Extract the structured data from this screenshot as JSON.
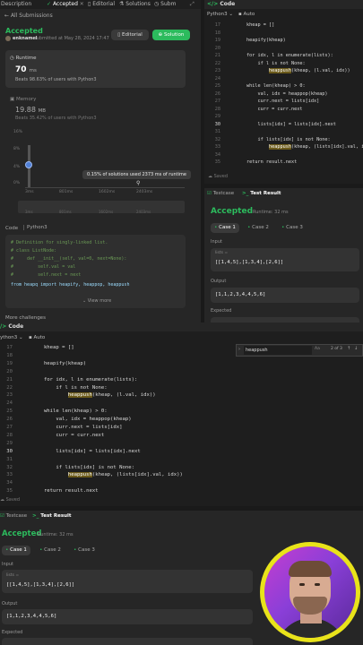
{
  "top_tabs": {
    "description": "Description",
    "accepted": "Accepted",
    "editorial": "Editorial",
    "solutions": "Solutions",
    "submissions_short": "Subm"
  },
  "left": {
    "back_label": "All Submissions",
    "status": "Accepted",
    "author": "enknamel",
    "submitted": "submitted at May 28, 2024 17:47",
    "editorial_btn": "Editorial",
    "solution_btn": "Solution",
    "runtime_label": "Runtime",
    "runtime_value": "70",
    "runtime_unit": "ms",
    "beats_runtime": "Beats 98.63% of users with Python3",
    "memory_label": "Memory",
    "memory_value": "19.88",
    "memory_unit": "MB",
    "beats_memory": "Beats 35.42% of users with Python3",
    "y_ticks": [
      "16%",
      "8%",
      "4%",
      "0%"
    ],
    "x_ticks": [
      "3ms",
      "801ms",
      "1602ms",
      "2403ms"
    ],
    "x_ticks2": [
      "3ms",
      "801ms",
      "1602ms",
      "2403ms"
    ],
    "tooltip": "0.15% of solutions used 2373 ms of runtime",
    "code_label": "Code",
    "lang": "Python3",
    "code_lines": [
      "# Definition for singly-linked list.",
      "# class ListNode:",
      "#     def __init__(self, val=0, next=None):",
      "#         self.val = val",
      "#         self.next = next",
      "",
      "from heapq import heapify, heappop, heappush"
    ],
    "view_more": "View more",
    "more_challenges": "More challenges"
  },
  "right": {
    "code_title": "Code",
    "lang": "Python3",
    "auto": "Auto",
    "line_numbers": [
      "17",
      "18",
      "19",
      "20",
      "21",
      "22",
      "23",
      "24",
      "25",
      "26",
      "27",
      "28",
      "29",
      "30",
      "31",
      "32",
      "33",
      "34",
      "35"
    ],
    "lines": [
      "        kheap = []",
      "",
      "        heapify(kheap)",
      "",
      "        for idx, l in enumerate(lists):",
      "            if l is not None:",
      "                heappush(kheap, (l.val, idx))",
      "",
      "        while len(kheap) > 0:",
      "            val, idx = heappop(kheap)",
      "            curr.next = lists[idx]",
      "            curr = curr.next",
      "",
      "            lists[idx] = lists[idx].next",
      "",
      "            if lists[idx] is not None:",
      "                heappush(kheap, (lists[idx].val, i",
      "",
      "        return result.next"
    ],
    "saved": "Saved",
    "testcase_tab": "Testcase",
    "result_tab": "Test Result",
    "status": "Accepted",
    "runtime": "Runtime: 32 ms",
    "cases": [
      "Case 1",
      "Case 2",
      "Case 3"
    ],
    "input_label": "Input",
    "input_var": "lists =",
    "input_value": "[[1,4,5],[1,3,4],[2,6]]",
    "output_label": "Output",
    "output_value": "[1,1,2,3,4,4,5,6]",
    "expected_label": "Expected"
  },
  "bottom": {
    "code_title": "Code",
    "lang": "ython3",
    "auto": "Auto",
    "search_text": "heappush",
    "search_count": "2 of 3",
    "line_numbers": [
      "17",
      "18",
      "19",
      "20",
      "21",
      "22",
      "23",
      "24",
      "25",
      "26",
      "27",
      "28",
      "29",
      "30",
      "31",
      "32",
      "33",
      "34",
      "35"
    ],
    "lines": [
      "        kheap = []",
      "",
      "        heapify(kheap)",
      "",
      "        for idx, l in enumerate(lists):",
      "            if l is not None:",
      "                heappush(kheap, (l.val, idx))",
      "",
      "        while len(kheap) > 0:",
      "            val, idx = heappop(kheap)",
      "            curr.next = lists[idx]",
      "            curr = curr.next",
      "",
      "            lists[idx] = lists[idx].next",
      "",
      "            if lists[idx] is not None:",
      "                heappush(kheap, (lists[idx].val, idx))",
      "",
      "        return result.next"
    ],
    "saved": "Saved",
    "testcase_tab": "Testcase",
    "result_tab": "Test Result",
    "status": "Accepted",
    "runtime": "Runtime: 32 ms",
    "cases": [
      "Case 1",
      "Case 2",
      "Case 3"
    ],
    "input_label": "Input",
    "input_var": "lists =",
    "input_value": "[[1,4,5],[1,3,4],[2,6]]",
    "output_label": "Output",
    "output_value": "[1,1,2,3,4,4,5,6]",
    "expected_label": "Expected"
  },
  "colors": {
    "accent_green": "#2cbb5d",
    "bg": "#1a1a1a",
    "panel": "#262626",
    "highlight": "#6b5a1a",
    "webcam_ring": "#e9e31a"
  }
}
